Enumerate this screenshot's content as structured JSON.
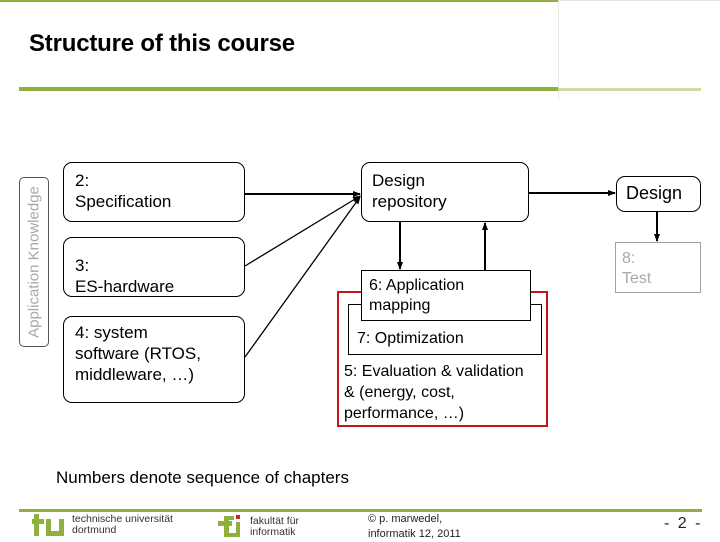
{
  "slide": {
    "title": "Structure of this course",
    "side_label": "Application Knowledge",
    "boxes": {
      "specification": [
        "2:",
        "Specification"
      ],
      "es_hardware": [
        "3:",
        "ES-hardware"
      ],
      "system_software": [
        "4: system",
        "software (RTOS,",
        "middleware, …)"
      ],
      "design_repository": [
        "Design",
        "repository"
      ],
      "design": "Design",
      "application_mapping": [
        "6: Application",
        "mapping"
      ],
      "optimization": "7: Optimization",
      "evaluation": [
        "5: Evaluation & validation",
        "& (energy, cost,",
        "performance, …)"
      ],
      "test": [
        "8:",
        "Test"
      ]
    },
    "note": "Numbers denote sequence of chapters",
    "colors": {
      "accent_green": "#8fb03e",
      "evaluation_frame_red": "#c0161c",
      "test_grey": "#a9a9a9"
    }
  },
  "footer": {
    "university": [
      "technische universität",
      "dortmund"
    ],
    "faculty": [
      "fakultät für",
      "informatik"
    ],
    "copyright": [
      "© p. marwedel,",
      "informatik 12,  2011"
    ],
    "page_number": "- 2 -"
  }
}
